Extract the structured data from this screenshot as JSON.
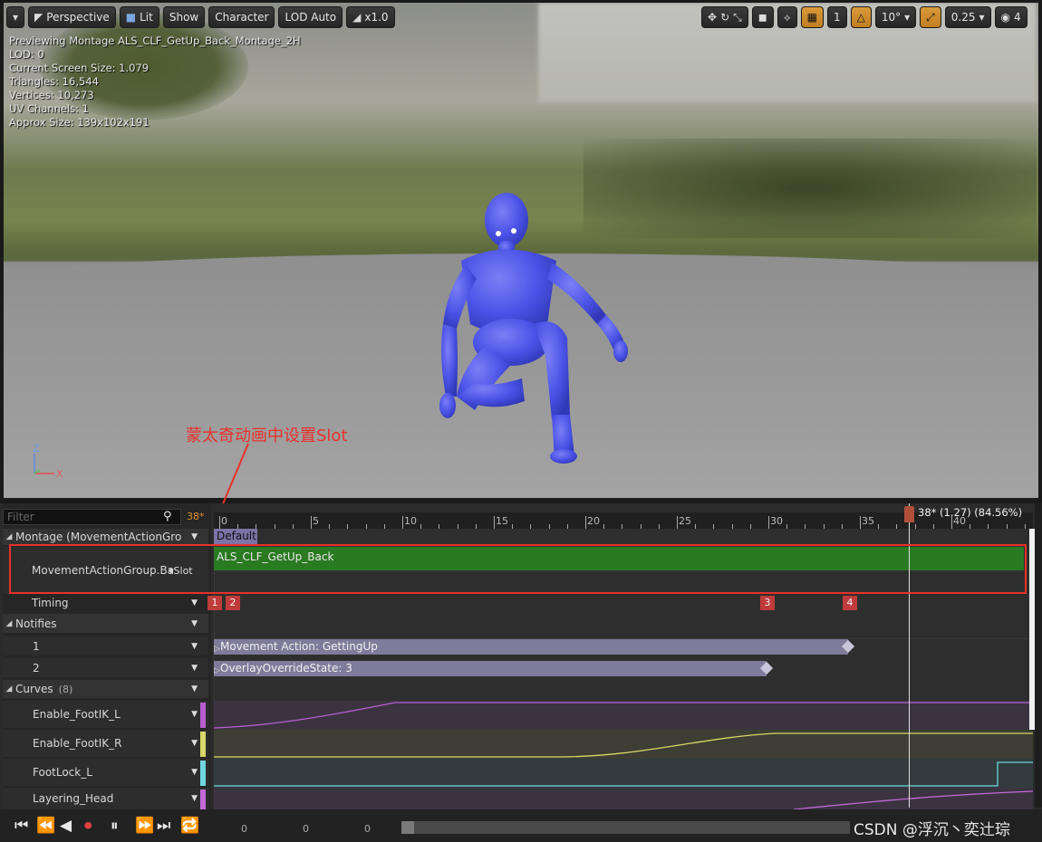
{
  "toolbar": {
    "left": [
      {
        "key": "menu",
        "label": ""
      },
      {
        "key": "perspective",
        "label": "Perspective"
      },
      {
        "key": "lit",
        "label": "Lit"
      },
      {
        "key": "show",
        "label": "Show"
      },
      {
        "key": "character",
        "label": "Character"
      },
      {
        "key": "lod",
        "label": "LOD Auto"
      },
      {
        "key": "speed",
        "label": "x1.0"
      }
    ],
    "right": {
      "grid_snap": "1",
      "angle_snap": "10°",
      "scale_snap": "0.25",
      "camera_speed": "4"
    }
  },
  "viewport_info": [
    "Previewing Montage ALS_CLF_GetUp_Back_Montage_2H",
    "LOD: 0",
    "Current Screen Size: 1.079",
    "Triangles: 16,544",
    "Vertices: 10,273",
    "UV Channels: 1",
    "Approx Size: 139x102x191"
  ],
  "axis": {
    "z": "Z",
    "x": "X"
  },
  "annotation": "蒙太奇动画中设置Slot",
  "timeline": {
    "filter_placeholder": "Filter",
    "current_frame": "38*",
    "ruler_labels": [
      "0",
      "5",
      "10",
      "15",
      "20",
      "25",
      "30",
      "35",
      "40"
    ],
    "playhead_label": "38* (1.27) (84.56%)",
    "playhead_fraction": 0.8456,
    "rows": {
      "montage": "Montage (MovementActionGro",
      "slot": "MovementActionGroup.Ba",
      "slot_dd": "Slot",
      "timing": "Timing",
      "notifies": "Notifies",
      "notify1": "1",
      "notify2": "2",
      "curves": "Curves",
      "curves_count": "(8)",
      "curve1": "Enable_FootIK_L",
      "curve2": "Enable_FootIK_R",
      "curve3": "FootLock_L",
      "curve4": "Layering_Head"
    },
    "section_tag": "Default",
    "anim_segment": "ALS_CLF_GetUp_Back",
    "timing_marks": [
      "1",
      "2",
      "3",
      "4"
    ],
    "notifies": [
      {
        "label": "Movement Action: GettingUp"
      },
      {
        "label": "OverlayOverrideState: 3"
      }
    ],
    "curve_colors": [
      "#b75fd0",
      "#d8d86a",
      "#6fd6e0",
      "#c36ad8"
    ],
    "transport_numbers": [
      "0",
      "0",
      "0"
    ]
  },
  "watermark": "CSDN @浮沉丶奕辻琮"
}
